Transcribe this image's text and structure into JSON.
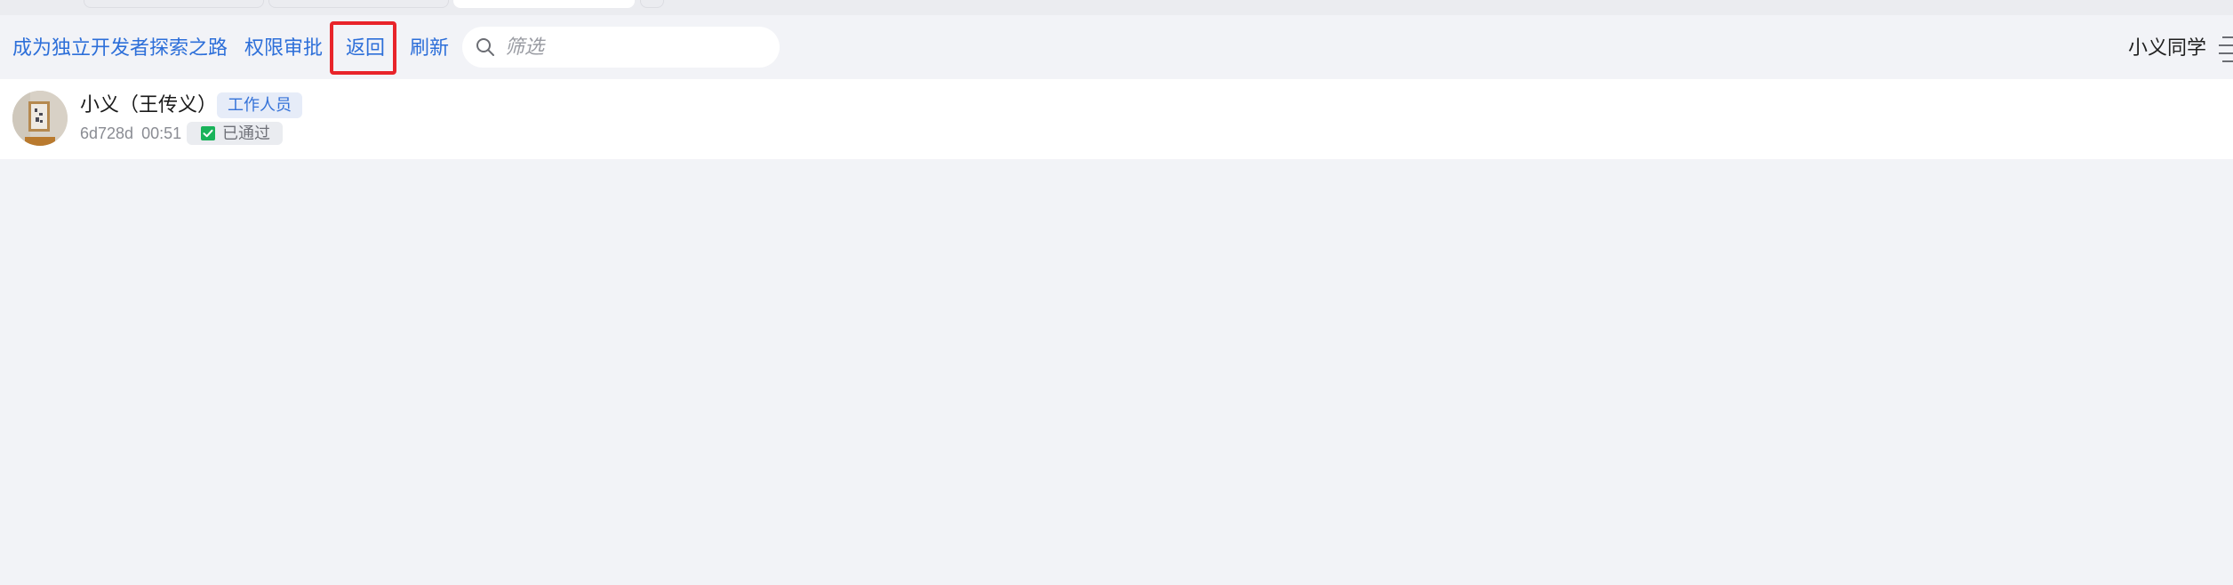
{
  "toolbar": {
    "links": {
      "project": "成为独立开发者探索之路",
      "approval": "权限审批",
      "back": "返回",
      "refresh": "刷新"
    },
    "search": {
      "placeholder": "筛选",
      "value": ""
    },
    "user_name": "小义同学"
  },
  "member": {
    "name": "小义（王传义）",
    "role": "工作人员",
    "id": "6d728d",
    "time": "00:51",
    "status": "已通过"
  },
  "colors": {
    "link": "#2d6fd9",
    "highlight": "#e8242a",
    "approved": "#19b35a",
    "background": "#f2f3f7"
  },
  "icons": [
    "search-icon",
    "check-icon",
    "list-settings-icon"
  ]
}
